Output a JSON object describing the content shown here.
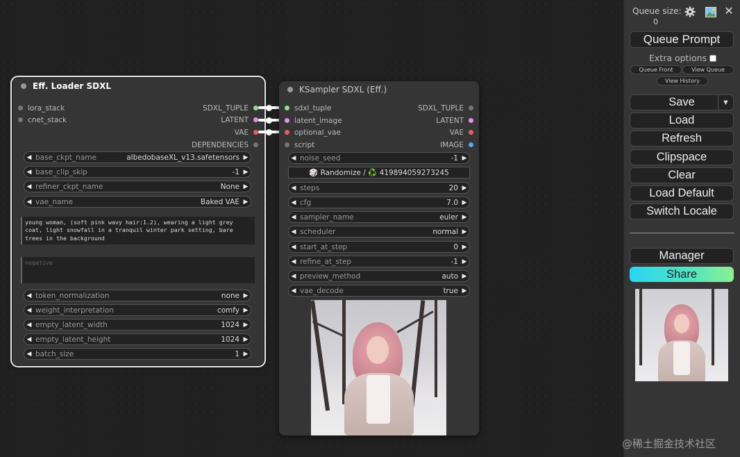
{
  "loader_node": {
    "title": "Eff. Loader SDXL",
    "inputs": [
      "lora_stack",
      "cnet_stack"
    ],
    "outputs": [
      "SDXL_TUPLE",
      "LATENT",
      "VAE",
      "DEPENDENCIES"
    ],
    "widgets": [
      {
        "label": "base_ckpt_name",
        "value": "albedobaseXL_v13.safetensors"
      },
      {
        "label": "base_clip_skip",
        "value": "-1"
      },
      {
        "label": "refiner_ckpt_name",
        "value": "None"
      },
      {
        "label": "vae_name",
        "value": "Baked VAE"
      }
    ],
    "positive_prompt": "young woman, (soft pink wavy hair:1.2), wearing a light grey coat, light snowfall in a tranquil winter park setting, bare trees in the background",
    "negative_placeholder": "negative",
    "widgets2": [
      {
        "label": "token_normalization",
        "value": "none"
      },
      {
        "label": "weight_interpretation",
        "value": "comfy"
      },
      {
        "label": "empty_latent_width",
        "value": "1024"
      },
      {
        "label": "empty_latent_height",
        "value": "1024"
      },
      {
        "label": "batch_size",
        "value": "1"
      }
    ]
  },
  "sampler_node": {
    "title": "KSampler SDXL (Eff.)",
    "inputs": [
      "sdxl_tuple",
      "latent_image",
      "optional_vae",
      "script"
    ],
    "outputs": [
      "SDXL_TUPLE",
      "LATENT",
      "VAE",
      "IMAGE"
    ],
    "noise_seed": {
      "label": "noise_seed",
      "value": "-1"
    },
    "randomize": "🎲 Randomize / ♻️ 419894059273245",
    "widgets": [
      {
        "label": "steps",
        "value": "20"
      },
      {
        "label": "cfg",
        "value": "7.0"
      },
      {
        "label": "sampler_name",
        "value": "euler"
      },
      {
        "label": "scheduler",
        "value": "normal"
      },
      {
        "label": "start_at_step",
        "value": "0"
      },
      {
        "label": "refine_at_step",
        "value": "-1"
      },
      {
        "label": "preview_method",
        "value": "auto"
      },
      {
        "label": "vae_decode",
        "value": "true"
      }
    ]
  },
  "sidebar": {
    "queue_size_label": "Queue size:",
    "queue_size": "0",
    "queue_prompt": "Queue Prompt",
    "extra_options": "Extra options",
    "queue_front": "Queue Front",
    "view_queue": "View Queue",
    "view_history": "View History",
    "buttons": [
      "Save",
      "Load",
      "Refresh",
      "Clipspace",
      "Clear",
      "Load Default",
      "Switch Locale"
    ],
    "manager": "Manager",
    "share": "Share",
    "icons": [
      "gear-icon",
      "image-icon",
      "close-icon"
    ]
  },
  "watermark": "@稀土掘金技术社区"
}
